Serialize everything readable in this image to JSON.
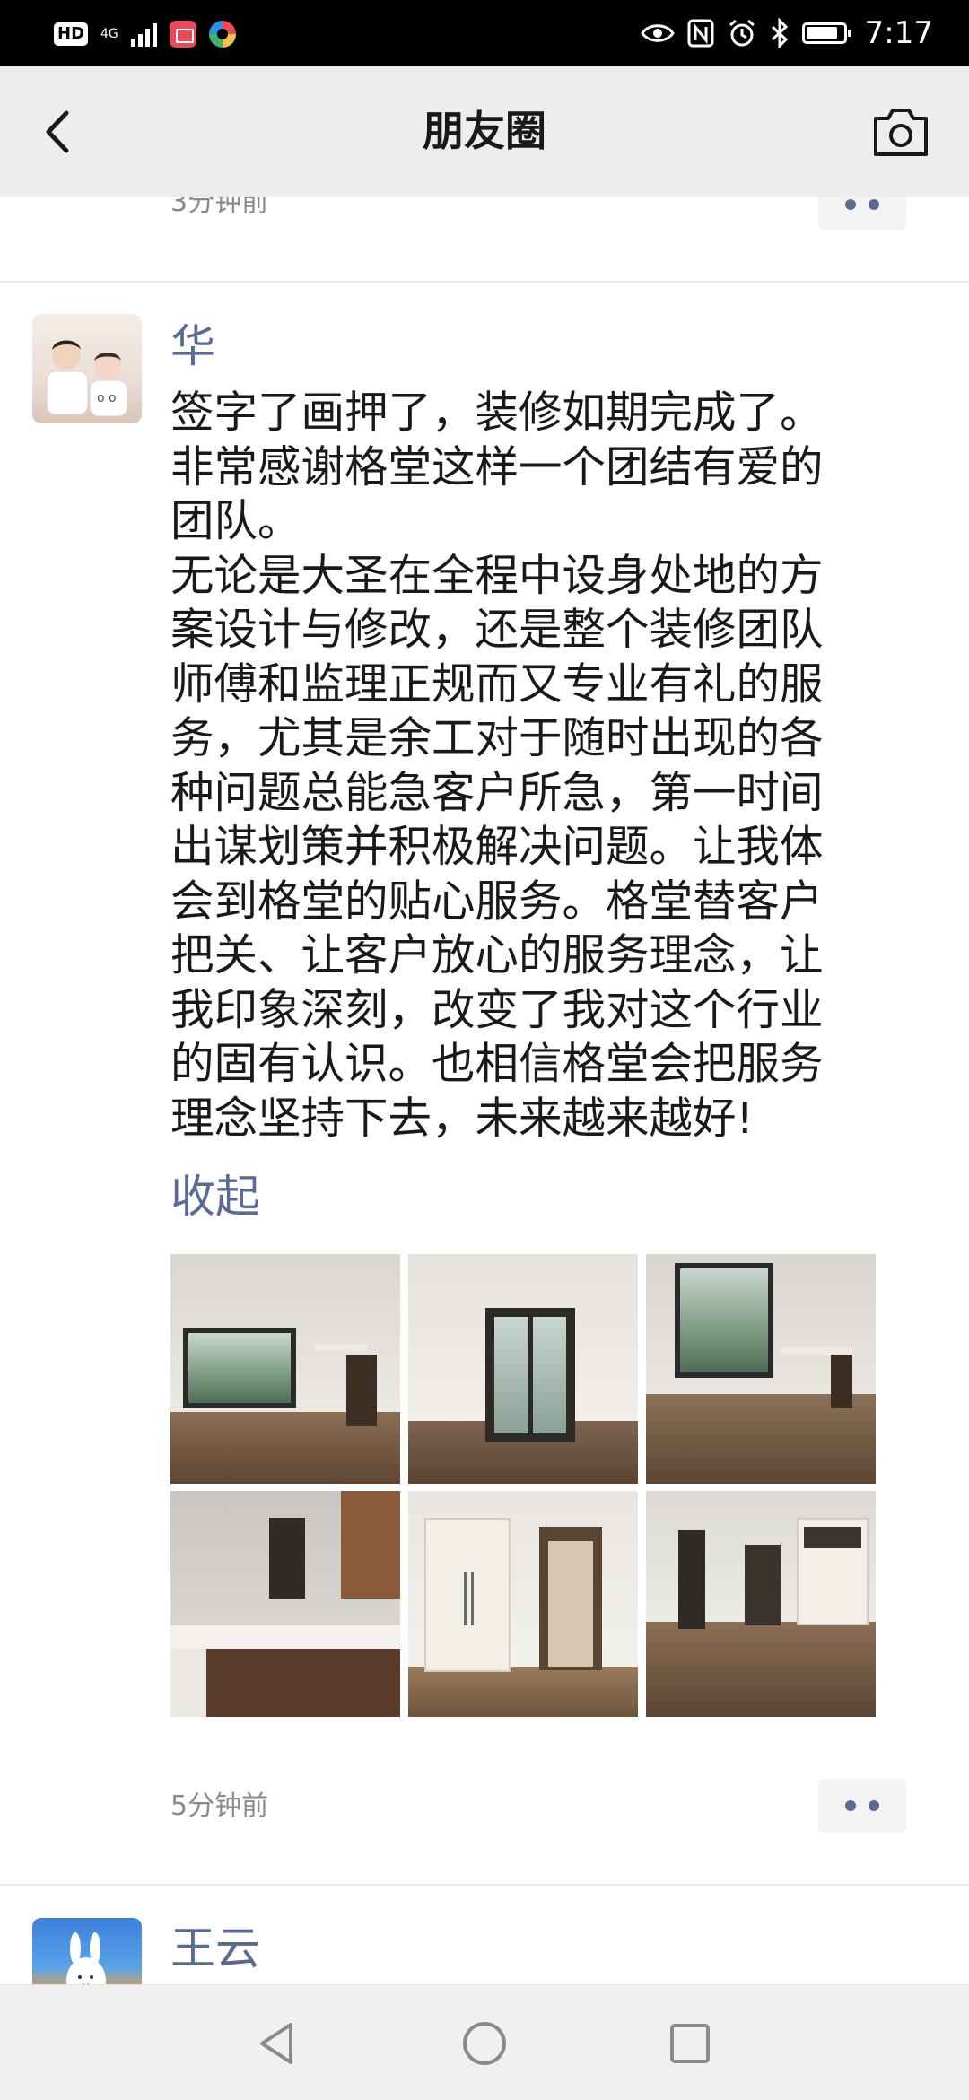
{
  "status_bar": {
    "hd_label": "HD",
    "network_label": "4G",
    "time": "7:17",
    "battery_level": 0.85,
    "icons": [
      "eye-icon",
      "nfc-icon",
      "alarm-icon",
      "bluetooth-icon"
    ]
  },
  "header": {
    "title": "朋友圈",
    "back_icon": "chevron-left-icon",
    "camera_icon": "camera-icon"
  },
  "previous_post": {
    "time": "3分钟前"
  },
  "post": {
    "author": "华",
    "body": "签字了画押了，装修如期完成了。\n非常感谢格堂这样一个团结有爱的\n团队。\n无论是大圣在全程中设身处地的方\n案设计与修改，还是整个装修团队\n师傅和监理正规而又专业有礼的服\n务，尤其是余工对于随时出现的各\n种问题总能急客户所急，第一时间\n出谋划策并积极解决问题。让我体\n会到格堂的贴心服务。格堂替客户\n把关、让客户放心的服务理念，让\n我印象深刻，改变了我对这个行业\n的固有认识。也相信格堂会把服务\n理念坚持下去，未来越来越好!",
    "collapse_label": "收起",
    "photo_count": 6,
    "time": "5分钟前"
  },
  "next_post": {
    "author": "王云"
  },
  "nav_bar": {
    "buttons": [
      "back-triangle-icon",
      "home-circle-icon",
      "recents-square-icon"
    ]
  },
  "colors": {
    "link_blue": "#576b95",
    "header_bg": "#ededed",
    "status_bar_bg": "#000000"
  }
}
